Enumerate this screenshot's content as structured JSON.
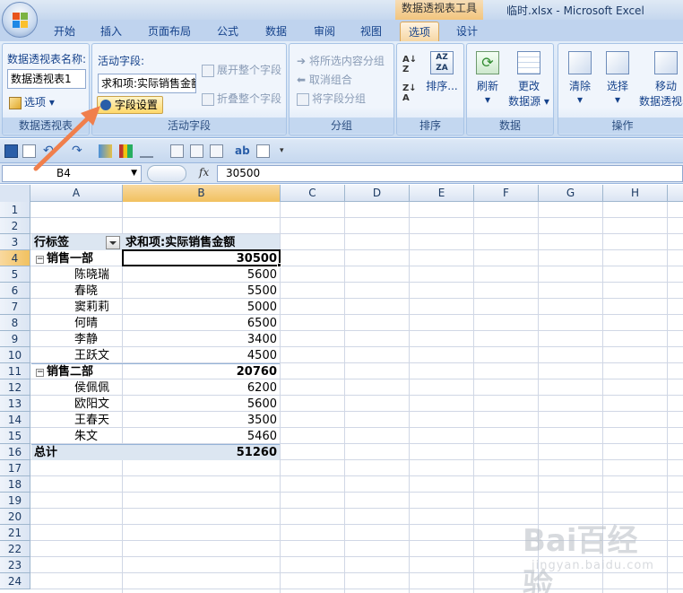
{
  "window": {
    "title": "临时.xlsx - Microsoft Excel",
    "context_tools": "数据透视表工具"
  },
  "tabs": [
    "开始",
    "插入",
    "页面布局",
    "公式",
    "数据",
    "审阅",
    "视图",
    "选项",
    "设计"
  ],
  "active_tab": "选项",
  "ribbon": {
    "pivot_group": {
      "name_label": "数据透视表名称:",
      "name_value": "数据透视表1",
      "options_label": "选项",
      "group_label": "数据透视表"
    },
    "active_field_group": {
      "label": "活动字段:",
      "value": "求和项:实际销售金额",
      "field_settings": "字段设置",
      "expand": "展开整个字段",
      "collapse": "折叠整个字段",
      "group_label": "活动字段"
    },
    "grouping_group": {
      "group_selection": "将所选内容分组",
      "ungroup": "取消组合",
      "group_field": "将字段分组",
      "group_label": "分组"
    },
    "sort_group": {
      "sort": "排序...",
      "group_label": "排序"
    },
    "data_group": {
      "refresh": "刷新",
      "change_source_line1": "更改",
      "change_source_line2": "数据源",
      "group_label": "数据"
    },
    "actions_group": {
      "clear": "清除",
      "select": "选择",
      "move_line1": "移动",
      "move_line2": "数据透视表",
      "group_label": "操作"
    }
  },
  "formula_bar": {
    "cell_ref": "B4",
    "fx": "fx",
    "content": "30500"
  },
  "columns": [
    "A",
    "B",
    "C",
    "D",
    "E",
    "F",
    "G",
    "H"
  ],
  "rows": [
    "1",
    "2",
    "3",
    "4",
    "5",
    "6",
    "7",
    "8",
    "9",
    "10",
    "11",
    "12",
    "13",
    "14",
    "15",
    "16",
    "17",
    "18",
    "19",
    "20",
    "21",
    "22",
    "23",
    "24"
  ],
  "pivot": {
    "header_row_label": "行标签",
    "header_value_label": "求和项:实际销售金额",
    "groups": [
      {
        "name": "销售一部",
        "total": "30500",
        "items": [
          {
            "name": "陈晓瑞",
            "value": "5600"
          },
          {
            "name": "春晓",
            "value": "5500"
          },
          {
            "name": "窦莉莉",
            "value": "5000"
          },
          {
            "name": "何晴",
            "value": "6500"
          },
          {
            "name": "李静",
            "value": "3400"
          },
          {
            "name": "王跃文",
            "value": "4500"
          }
        ]
      },
      {
        "name": "销售二部",
        "total": "20760",
        "items": [
          {
            "name": "侯佩佩",
            "value": "6200"
          },
          {
            "name": "欧阳文",
            "value": "5600"
          },
          {
            "name": "王春天",
            "value": "3500"
          },
          {
            "name": "朱文",
            "value": "5460"
          }
        ]
      }
    ],
    "grand_total_label": "总计",
    "grand_total": "51260"
  },
  "watermark": {
    "text": "Bai百经验",
    "sub": "jingyan.baidu.com"
  },
  "colors": {
    "ribbon_bg": "#c9dbf1",
    "active_tab": "#f6d7a5",
    "header_band": "#dce6f1",
    "arrow": "#f07f4c"
  }
}
